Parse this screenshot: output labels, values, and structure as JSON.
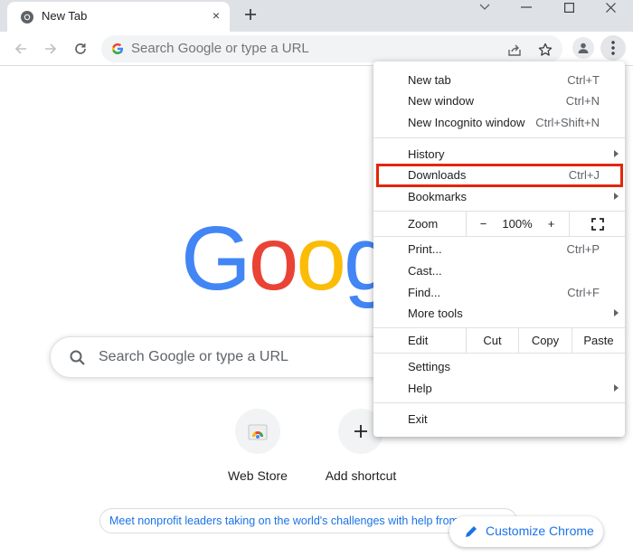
{
  "tab": {
    "title": "New Tab",
    "favicon": "chrome-icon",
    "close": "×"
  },
  "omnibox": {
    "placeholder": "Search Google or type a URL"
  },
  "logo": {
    "letters": [
      {
        "ch": "G",
        "color": "#4285f4"
      },
      {
        "ch": "o",
        "color": "#ea4335"
      },
      {
        "ch": "o",
        "color": "#fbbc05"
      },
      {
        "ch": "g",
        "color": "#4285f4"
      }
    ]
  },
  "search": {
    "placeholder": "Search Google or type a URL"
  },
  "shortcuts": [
    {
      "label": "Web Store",
      "icon": "web-store-icon"
    },
    {
      "label": "Add shortcut",
      "icon": "plus-icon"
    }
  ],
  "promo": {
    "text": "Meet nonprofit leaders taking on the world's challenges with help from"
  },
  "customize": {
    "label": "Customize Chrome",
    "icon": "pencil-icon"
  },
  "menu": {
    "group1": [
      {
        "label": "New tab",
        "shortcut": "Ctrl+T"
      },
      {
        "label": "New window",
        "shortcut": "Ctrl+N"
      },
      {
        "label": "New Incognito window",
        "shortcut": "Ctrl+Shift+N"
      }
    ],
    "history": {
      "label": "History"
    },
    "downloads": {
      "label": "Downloads",
      "shortcut": "Ctrl+J"
    },
    "bookmarks": {
      "label": "Bookmarks"
    },
    "zoom": {
      "label": "Zoom",
      "minus": "−",
      "level": "100%",
      "plus": "+"
    },
    "group3": [
      {
        "label": "Print...",
        "shortcut": "Ctrl+P"
      },
      {
        "label": "Cast...",
        "shortcut": ""
      },
      {
        "label": "Find...",
        "shortcut": "Ctrl+F"
      }
    ],
    "more_tools": {
      "label": "More tools"
    },
    "edit": {
      "label": "Edit",
      "cut": "Cut",
      "copy": "Copy",
      "paste": "Paste"
    },
    "settings": {
      "label": "Settings"
    },
    "help": {
      "label": "Help"
    },
    "exit": {
      "label": "Exit"
    }
  },
  "colors": {
    "highlight": "#e2260d",
    "link": "#1a73e8",
    "tabstrip": "#dee1e6"
  }
}
